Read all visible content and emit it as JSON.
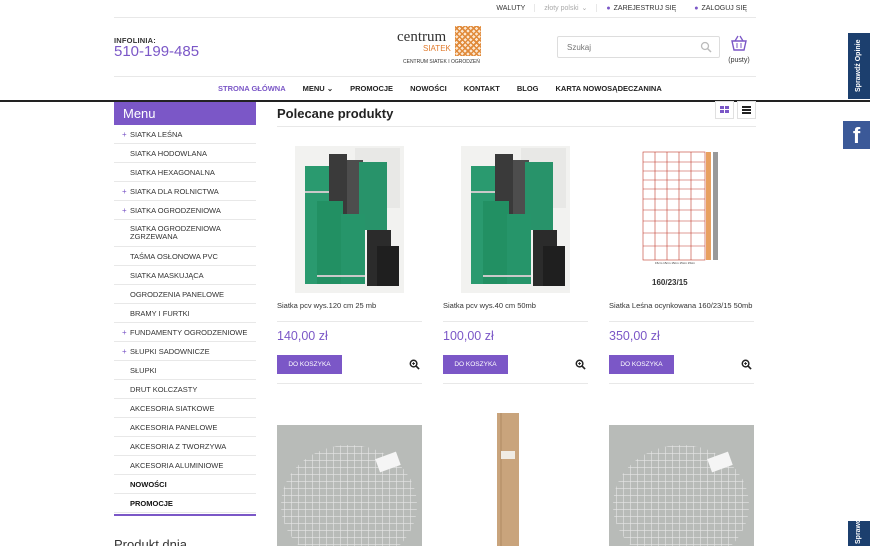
{
  "topbar": {
    "waluty": "WALUTY",
    "language": "złoty polski",
    "register": "ZAREJESTRUJ SIĘ",
    "login": "ZALOGUJ SIĘ"
  },
  "header": {
    "infolinia_label": "INFOLINIA:",
    "phone": "510-199-485",
    "logo_word1": "centrum",
    "logo_word2": "SIATEK",
    "logo_tagline": "CENTRUM SIATEK I OGRODZEŃ",
    "search_placeholder": "Szukaj",
    "cart_label": "(pusty)"
  },
  "nav": {
    "items": [
      {
        "label": "STRONA GŁÓWNA"
      },
      {
        "label": "MENU"
      },
      {
        "label": "PROMOCJE"
      },
      {
        "label": "NOWOŚCI"
      },
      {
        "label": "KONTAKT"
      },
      {
        "label": "BLOG"
      },
      {
        "label": "KARTA NOWOSĄDECZANINA"
      }
    ]
  },
  "sidebar": {
    "title": "Menu",
    "items": [
      {
        "label": "SIATKA LEŚNA"
      },
      {
        "label": "SIATKA HODOWLANA"
      },
      {
        "label": "SIATKA HEXAGONALNA"
      },
      {
        "label": "SIATKA DLA ROLNICTWA"
      },
      {
        "label": "SIATKA OGRODZENIOWA"
      },
      {
        "label": "SIATKA OGRODZENIOWA ZGRZEWANA"
      },
      {
        "label": "TAŚMA OSŁONOWA PVC"
      },
      {
        "label": "SIATKA MASKUJĄCA"
      },
      {
        "label": "OGRODZENIA PANELOWE"
      },
      {
        "label": "BRAMY I FURTKI"
      },
      {
        "label": "FUNDAMENTY OGRODZENIOWE"
      },
      {
        "label": "SŁUPKI SADOWNICZE"
      },
      {
        "label": "SŁUPKI"
      },
      {
        "label": "DRUT KOLCZASTY"
      },
      {
        "label": "AKCESORIA SIATKOWE"
      },
      {
        "label": "AKCESORIA PANELOWE"
      },
      {
        "label": "AKCESORIA Z TWORZYWA"
      },
      {
        "label": "AKCESORIA ALUMINIOWE"
      },
      {
        "label": "NOWOŚCI"
      },
      {
        "label": "PROMOCJE"
      }
    ],
    "produkt_dnia": "Produkt dnia"
  },
  "main": {
    "title": "Polecane produkty",
    "add_to_cart": "DO KOSZYKA",
    "products": [
      {
        "name": "Siatka pcv wys.120 cm 25 mb",
        "price": "140,00 zł"
      },
      {
        "name": "Siatka pcv wys.40 cm 50mb",
        "price": "100,00 zł"
      },
      {
        "name": "Siatka Leśna ocynkowana 160/23/15 50mb",
        "price": "350,00 zł",
        "image_caption": "160/23/15"
      }
    ]
  },
  "side_tabs": {
    "opinie": "Sprawdź Opinie",
    "facebook": "f"
  },
  "colors": {
    "accent": "#7b57c7",
    "dark_tab": "#1c3f6e",
    "facebook": "#3b5998"
  }
}
